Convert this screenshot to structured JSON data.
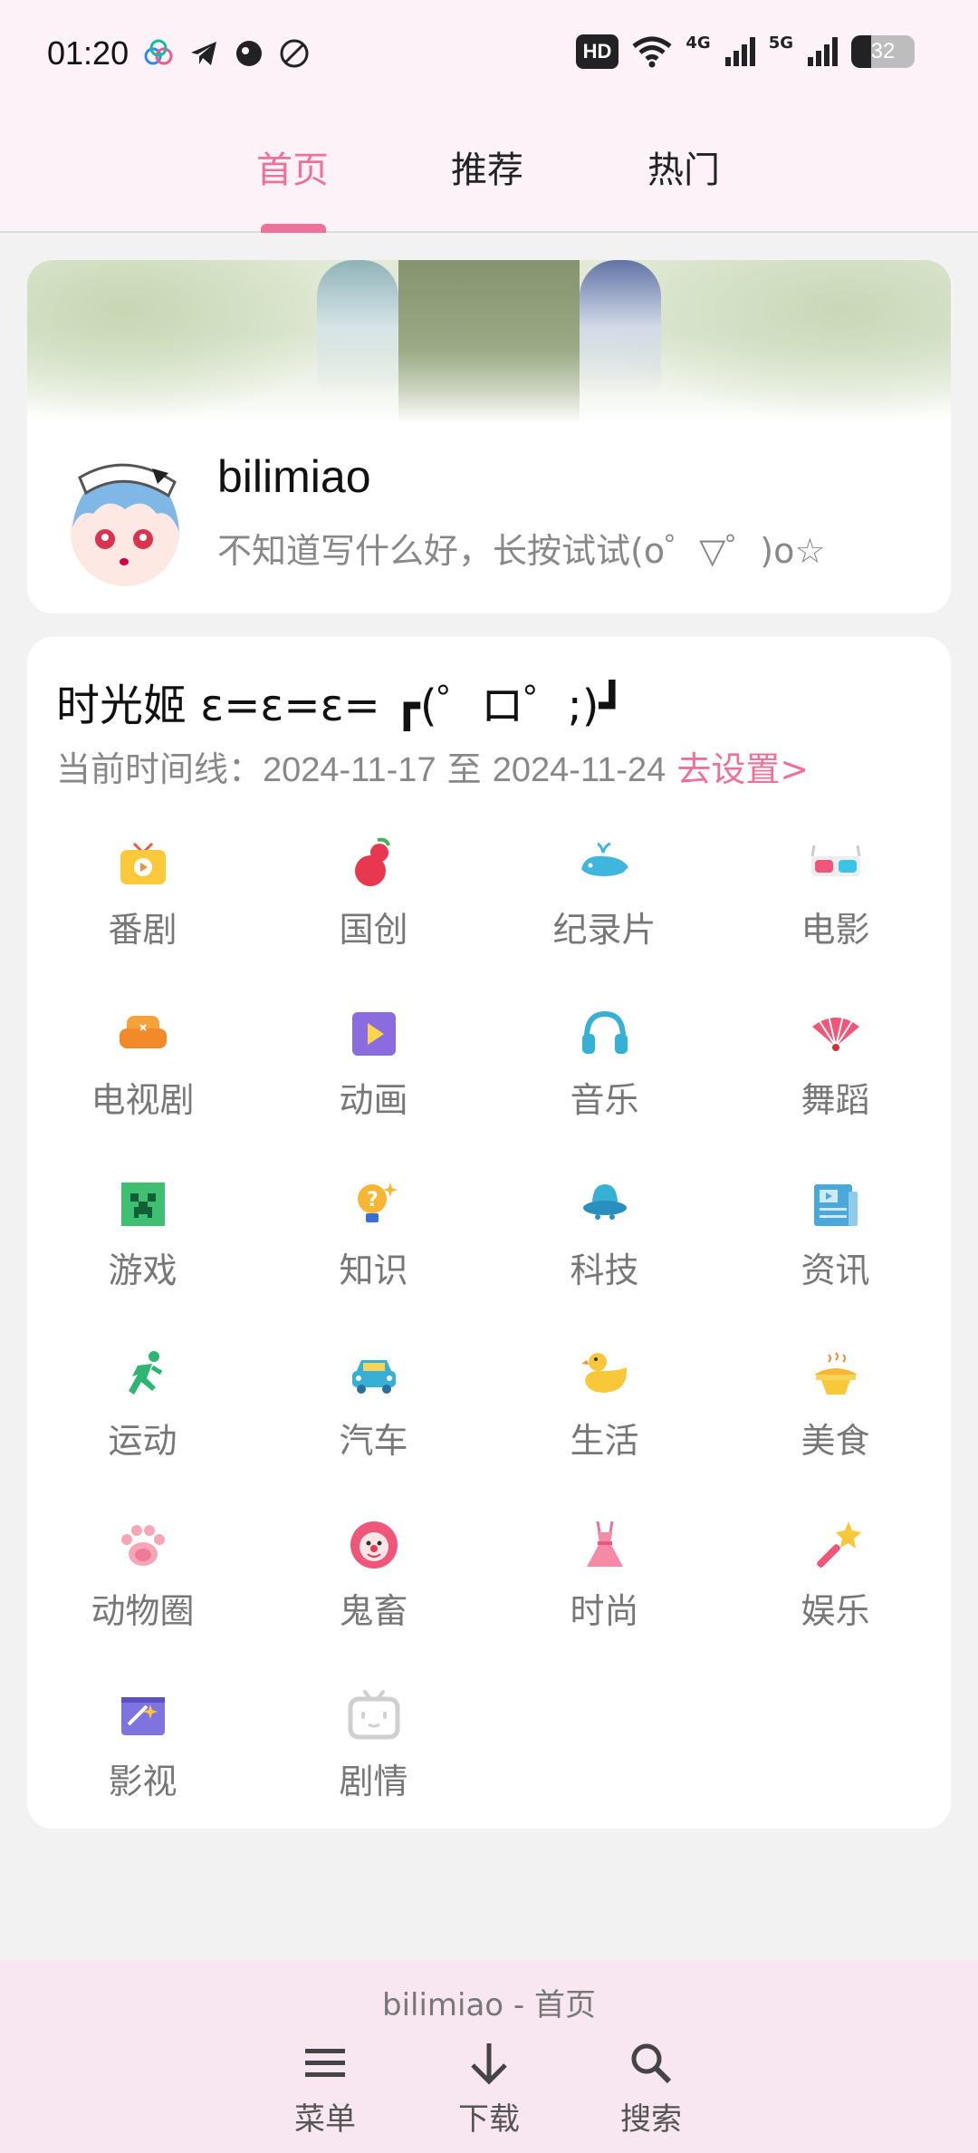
{
  "status_bar": {
    "time": "01:20",
    "hd": "HD",
    "net1": "4G",
    "net2": "5G",
    "battery": "32"
  },
  "tabs": [
    {
      "label": "首页",
      "active": true
    },
    {
      "label": "推荐",
      "active": false
    },
    {
      "label": "热门",
      "active": false
    }
  ],
  "profile": {
    "username": "bilimiao",
    "signature": "不知道写什么好，长按试试(o゜▽゜)o☆"
  },
  "timeline": {
    "title": "时光姬 ε=ε=ε= ┏(゜ロ゜;)┛",
    "sub_prefix": "当前时间线：",
    "start_date": "2024-11-17",
    "sep": " 至 ",
    "end_date": "2024-11-24",
    "link": "去设置>"
  },
  "categories": [
    {
      "label": "番剧",
      "icon": "tv-icon"
    },
    {
      "label": "国创",
      "icon": "gourd-icon"
    },
    {
      "label": "纪录片",
      "icon": "whale-icon"
    },
    {
      "label": "电影",
      "icon": "3d-glasses-icon"
    },
    {
      "label": "电视剧",
      "icon": "sofa-icon"
    },
    {
      "label": "动画",
      "icon": "play-icon"
    },
    {
      "label": "音乐",
      "icon": "headphones-icon"
    },
    {
      "label": "舞蹈",
      "icon": "fan-icon"
    },
    {
      "label": "游戏",
      "icon": "creeper-icon"
    },
    {
      "label": "知识",
      "icon": "bulb-icon"
    },
    {
      "label": "科技",
      "icon": "ufo-icon"
    },
    {
      "label": "资讯",
      "icon": "news-icon"
    },
    {
      "label": "运动",
      "icon": "runner-icon"
    },
    {
      "label": "汽车",
      "icon": "car-icon"
    },
    {
      "label": "生活",
      "icon": "duck-icon"
    },
    {
      "label": "美食",
      "icon": "food-icon"
    },
    {
      "label": "动物圈",
      "icon": "paw-icon"
    },
    {
      "label": "鬼畜",
      "icon": "clown-icon"
    },
    {
      "label": "时尚",
      "icon": "dress-icon"
    },
    {
      "label": "娱乐",
      "icon": "wand-icon"
    },
    {
      "label": "影视",
      "icon": "clapper-icon"
    },
    {
      "label": "剧情",
      "icon": "bilibili-tv-icon"
    }
  ],
  "bottom": {
    "title": "bilimiao - 首页",
    "nav": [
      {
        "label": "菜单",
        "icon": "menu-icon"
      },
      {
        "label": "下载",
        "icon": "download-icon"
      },
      {
        "label": "搜索",
        "icon": "search-icon"
      }
    ]
  },
  "colors": {
    "accent": "#f07198",
    "header_bg": "#fcf2f8",
    "bottom_bg": "#f8e6f0"
  }
}
